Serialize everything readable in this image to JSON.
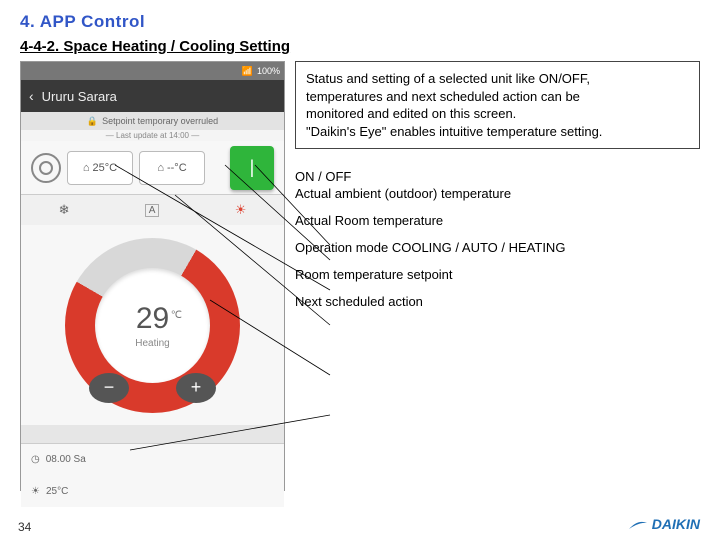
{
  "title": "4. APP Control",
  "subtitle": "4-4-2. Space Heating / Cooling Setting",
  "description": {
    "l1": "Status and setting of a selected unit like ON/OFF,",
    "l2": "temperatures and next scheduled action can be",
    "l3": "monitored and edited on this screen.",
    "l4": "\"Daikin's Eye\" enables intuitive temperature setting."
  },
  "annotations": {
    "a1a": "ON / OFF",
    "a1b": "Actual ambient (outdoor) temperature",
    "a2": "Actual Room temperature",
    "a3": "Operation mode COOLING / AUTO / HEATING",
    "a4": "Room temperature setpoint",
    "a5": "Next scheduled action"
  },
  "phone": {
    "status_time": "100%",
    "app_title": "Ururu Sarara",
    "banner": "Setpoint temporary overruled",
    "last_update": "— Last update at 14:00 —",
    "room_temp": "25°C",
    "outdoor_temp": "--°C",
    "power_icon": "|",
    "modes": {
      "cool": "❄",
      "auto": "A",
      "heat": "☀"
    },
    "dial_temp": "29",
    "dial_unit": "℃",
    "dial_mode": "Heating",
    "minus": "−",
    "plus": "+",
    "sched_time": "08.00 Sa",
    "sched_temp": "25°C",
    "home_icon": "⌂",
    "clock_icon": "◷",
    "sun_icon": "☀"
  },
  "page_number": "34",
  "brand": "DAIKIN"
}
